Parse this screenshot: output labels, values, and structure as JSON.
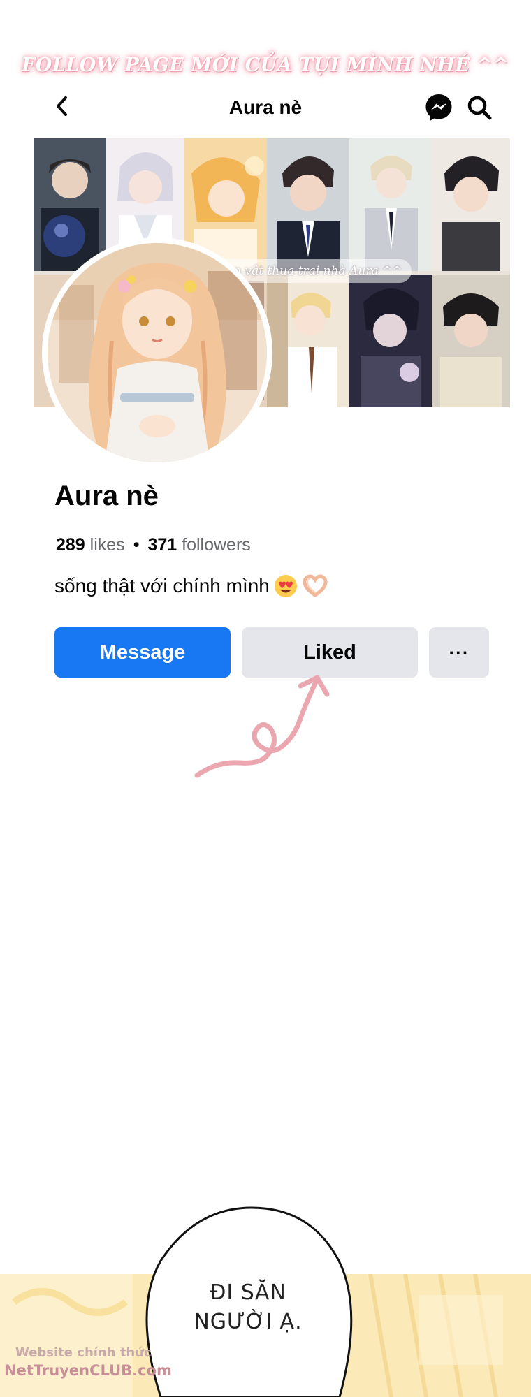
{
  "promo_banner": "FOLLOW PAGE MỚI CỦA TỤI MÌNH NHÉ ^^",
  "header": {
    "title": "Aura nè",
    "back_icon": "chevron-left-icon",
    "messenger_icon": "messenger-icon",
    "search_icon": "search-icon"
  },
  "cover": {
    "caption": "an vật thua trai nhà Aura ^^"
  },
  "profile": {
    "name": "Aura nè",
    "likes_count": "289",
    "likes_label": "likes",
    "separator": "•",
    "followers_count": "371",
    "followers_label": "followers",
    "bio": "sống thật với chính mình",
    "bio_emojis": [
      "heart-eyes-icon",
      "heart-hands-icon"
    ]
  },
  "actions": {
    "message_label": "Message",
    "liked_label": "Liked",
    "more_label": "···"
  },
  "comic_panel": {
    "speech_line1": "ĐI SĂN",
    "speech_line2": "NGƯỜI Ạ.",
    "watermark_line1": "Website chính thức",
    "watermark_line2": "NetTruyenCLUB.com"
  },
  "colors": {
    "primary_button": "#1877f2",
    "secondary_button": "#e4e6eb",
    "banner_glow": "#f2a2b0",
    "doodle": "#eaa7b0"
  }
}
